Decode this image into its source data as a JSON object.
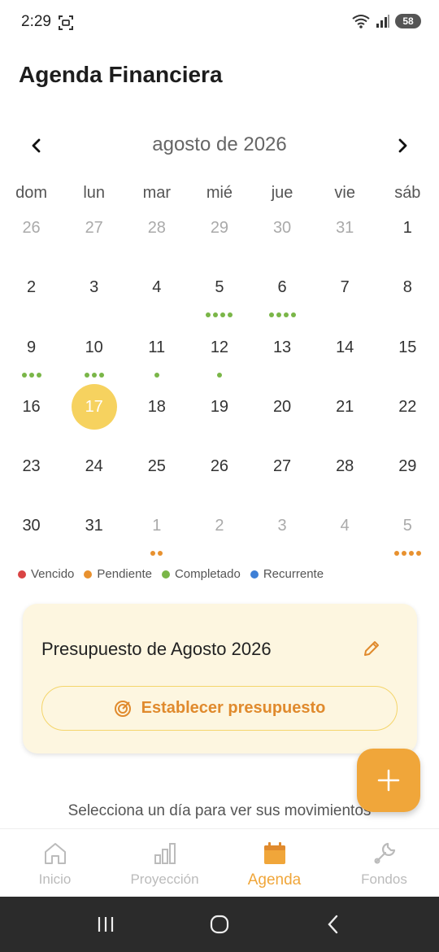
{
  "status": {
    "time": "2:29",
    "battery": "58"
  },
  "header": {
    "title": "Agenda Financiera"
  },
  "calendar": {
    "month_label": "agosto de 2026",
    "weekdays": [
      "dom",
      "lun",
      "mar",
      "mié",
      "jue",
      "vie",
      "sáb"
    ],
    "weeks": [
      [
        {
          "d": "26",
          "muted": true
        },
        {
          "d": "27",
          "muted": true
        },
        {
          "d": "28",
          "muted": true
        },
        {
          "d": "29",
          "muted": true
        },
        {
          "d": "30",
          "muted": true
        },
        {
          "d": "31",
          "muted": true
        },
        {
          "d": "1"
        }
      ],
      [
        {
          "d": "2"
        },
        {
          "d": "3"
        },
        {
          "d": "4"
        },
        {
          "d": "5",
          "dots": [
            "g",
            "g",
            "g",
            "g"
          ]
        },
        {
          "d": "6",
          "dots": [
            "g",
            "g",
            "g",
            "g"
          ]
        },
        {
          "d": "7"
        },
        {
          "d": "8"
        }
      ],
      [
        {
          "d": "9",
          "dots": [
            "g",
            "g",
            "g"
          ]
        },
        {
          "d": "10",
          "dots": [
            "g",
            "g",
            "g"
          ]
        },
        {
          "d": "11",
          "dots": [
            "g"
          ]
        },
        {
          "d": "12",
          "dots": [
            "g"
          ]
        },
        {
          "d": "13"
        },
        {
          "d": "14"
        },
        {
          "d": "15"
        }
      ],
      [
        {
          "d": "16"
        },
        {
          "d": "17",
          "today": true
        },
        {
          "d": "18"
        },
        {
          "d": "19"
        },
        {
          "d": "20"
        },
        {
          "d": "21"
        },
        {
          "d": "22"
        }
      ],
      [
        {
          "d": "23"
        },
        {
          "d": "24"
        },
        {
          "d": "25"
        },
        {
          "d": "26"
        },
        {
          "d": "27"
        },
        {
          "d": "28"
        },
        {
          "d": "29"
        }
      ],
      [
        {
          "d": "30"
        },
        {
          "d": "31"
        },
        {
          "d": "1",
          "muted": true,
          "dots": [
            "o",
            "o"
          ]
        },
        {
          "d": "2",
          "muted": true
        },
        {
          "d": "3",
          "muted": true
        },
        {
          "d": "4",
          "muted": true
        },
        {
          "d": "5",
          "muted": true,
          "dots": [
            "o",
            "o",
            "o",
            "o"
          ]
        }
      ]
    ],
    "dot_colors": {
      "g": "#7ab648",
      "o": "#e8912f"
    }
  },
  "legend": [
    {
      "label": "Vencido",
      "color": "#d94444"
    },
    {
      "label": "Pendiente",
      "color": "#e8912f"
    },
    {
      "label": "Completado",
      "color": "#7ab648"
    },
    {
      "label": "Recurrente",
      "color": "#3d7fd6"
    }
  ],
  "budget": {
    "title": "Presupuesto de Agosto 2026",
    "button_label": "Establecer presupuesto"
  },
  "hint": "Selecciona un día para ver sus movimientos",
  "nav": {
    "items": [
      {
        "label": "Inicio",
        "icon": "home-icon"
      },
      {
        "label": "Proyección",
        "icon": "chart-icon"
      },
      {
        "label": "Agenda",
        "icon": "calendar-icon",
        "active": true
      },
      {
        "label": "Fondos",
        "icon": "wrench-icon"
      }
    ]
  },
  "accent_color": "#f0a63a"
}
